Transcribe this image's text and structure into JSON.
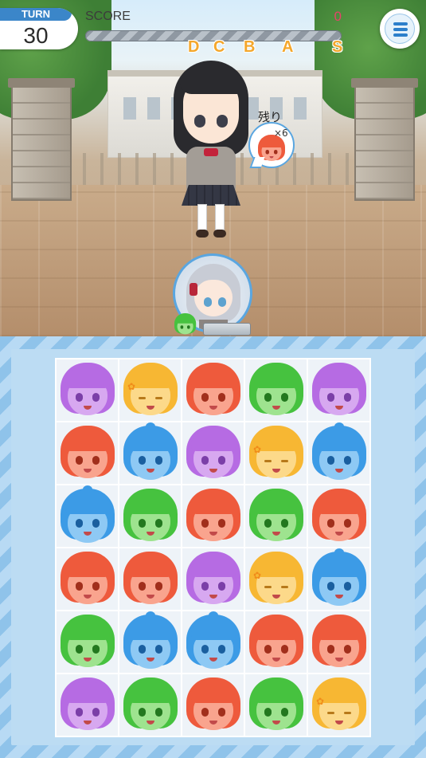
{
  "turn": {
    "label": "TURN",
    "value": "30"
  },
  "score": {
    "label": "SCORE",
    "value": "0",
    "progress": 0
  },
  "ranks": [
    "D",
    "C",
    "B",
    "A",
    "S"
  ],
  "remaining": {
    "label": "残り",
    "count": "×6",
    "target_color": "red"
  },
  "player": {
    "attribute": "green"
  },
  "colors": {
    "purple": "#b66be3",
    "orange": "#f7b733",
    "red": "#ee5a3c",
    "green": "#46c23f",
    "blue": "#3c9be6",
    "accent": "#3b86c9",
    "score_text": "#e5436a",
    "rank_text": "#f4a72c"
  },
  "board": {
    "columns": 5,
    "rows": [
      [
        "purple",
        "orange",
        "red",
        "green",
        "purple"
      ],
      [
        "red",
        "blue",
        "purple",
        "orange",
        "blue"
      ],
      [
        "blue",
        "green",
        "red",
        "green",
        "red"
      ],
      [
        "red",
        "red",
        "purple",
        "orange",
        "blue"
      ],
      [
        "green",
        "blue",
        "blue",
        "red",
        "red"
      ],
      [
        "purple",
        "green",
        "red",
        "green",
        "orange"
      ]
    ]
  }
}
